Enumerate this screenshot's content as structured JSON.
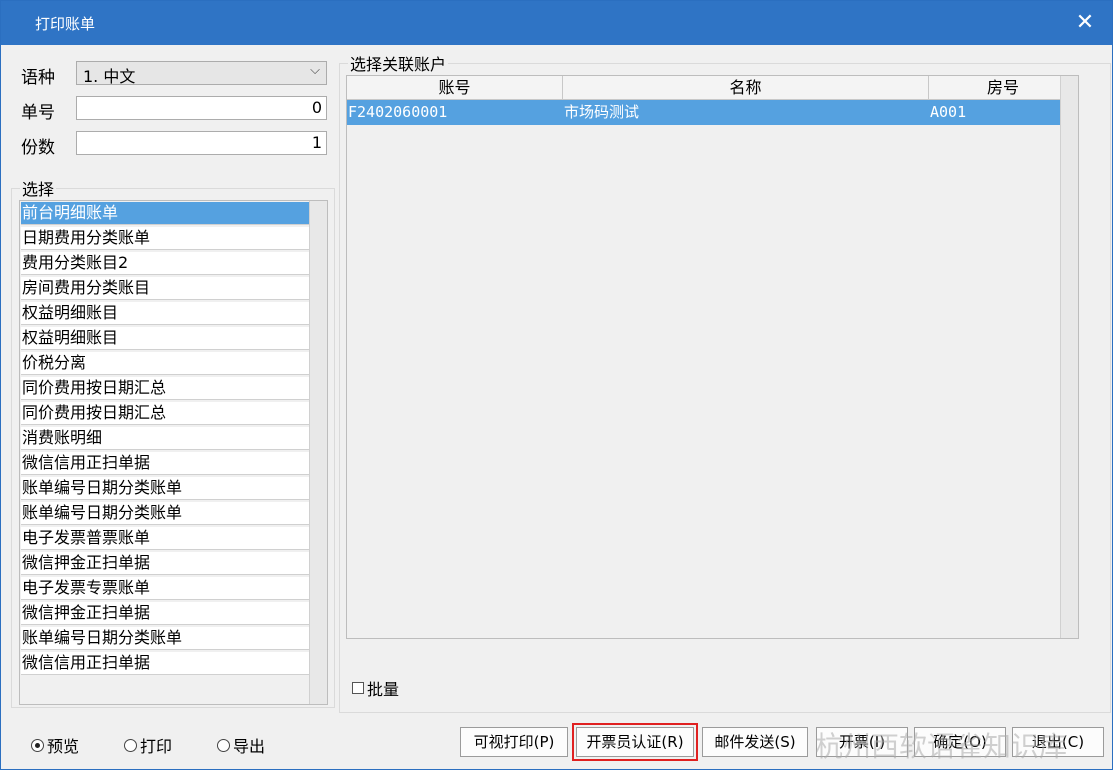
{
  "window": {
    "title": "打印账单"
  },
  "form": {
    "language_label": "语种",
    "language_value": "1. 中文",
    "bill_no_label": "单号",
    "bill_no_value": "0",
    "copies_label": "份数",
    "copies_value": "1"
  },
  "choose": {
    "legend": "选择",
    "items": [
      "前台明细账单",
      "日期费用分类账单",
      "费用分类账目2",
      "房间费用分类账目",
      "权益明细账目",
      "权益明细账目",
      "价税分离",
      "同价费用按日期汇总",
      "同价费用按日期汇总",
      "消费账明细",
      "微信信用正扫单据",
      "账单编号日期分类账单",
      "账单编号日期分类账单",
      "电子发票普票账单",
      "微信押金正扫单据",
      "电子发票专票账单",
      "微信押金正扫单据",
      "账单编号日期分类账单",
      "微信信用正扫单据"
    ],
    "selected_index": 0
  },
  "accounts": {
    "legend": "选择关联账户",
    "columns": [
      "账号",
      "名称",
      "房号"
    ],
    "rows": [
      {
        "account": "F2402060001",
        "name": "市场码测试",
        "room": "A001"
      }
    ],
    "batch_label": "批量"
  },
  "output": {
    "options": [
      "预览",
      "打印",
      "导出"
    ],
    "selected": "预览"
  },
  "buttons": {
    "visual_print": "可视打印(P)",
    "cashier_auth": "开票员认证(R)",
    "send_mail": "邮件发送(S)",
    "invoice": "开票(I)",
    "confirm": "确定(O)",
    "exit": "退出(C)"
  },
  "watermark": "杭州西软语雀知识库",
  "colors": {
    "title_bar": "#2f74c5",
    "selection": "#55a1e0",
    "highlight_border": "#e02020"
  }
}
